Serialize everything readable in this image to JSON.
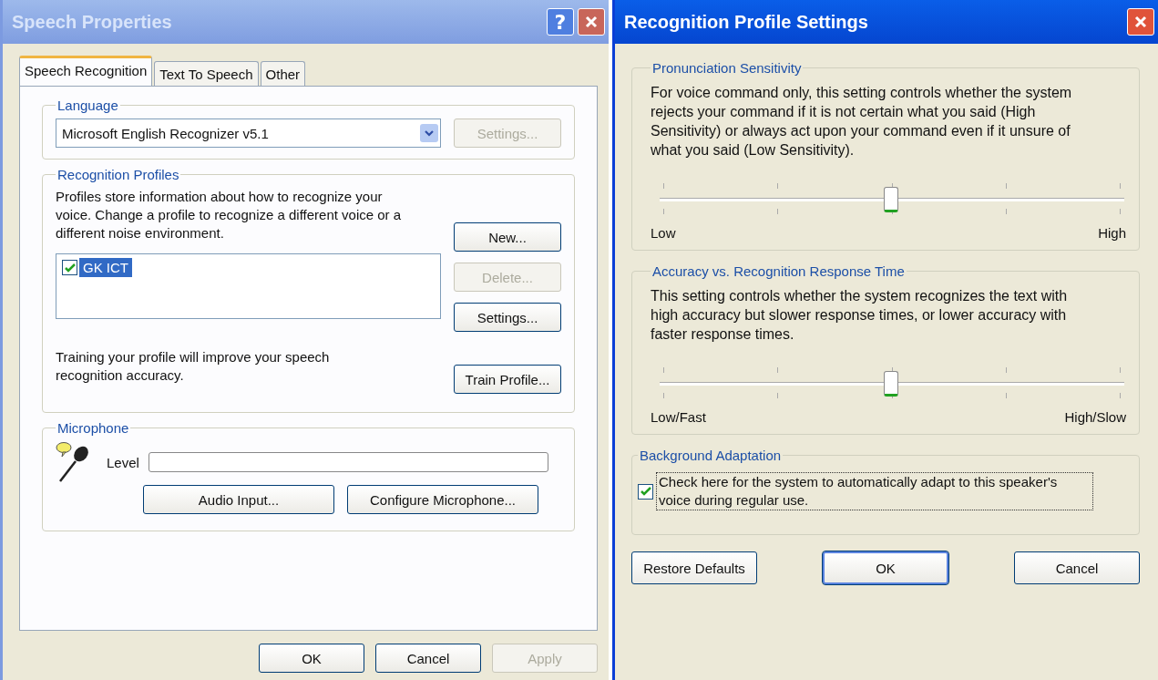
{
  "speech_properties": {
    "title": "Speech Properties",
    "active": false,
    "help": "?",
    "tabs": [
      {
        "label": "Speech Recognition",
        "selected": true
      },
      {
        "label": "Text To Speech",
        "selected": false
      },
      {
        "label": "Other",
        "selected": false
      }
    ],
    "language": {
      "legend": "Language",
      "value": "Microsoft English Recognizer v5.1",
      "button": {
        "label": "Settings...",
        "disabled": true
      }
    },
    "profiles": {
      "legend": "Recognition Profiles",
      "description": "Profiles store information about how to recognize your voice.  Change a profile to recognize a different voice or a different noise environment.",
      "items": [
        {
          "label": "GK ICT",
          "checked": true,
          "selected": true
        }
      ],
      "buttons": [
        {
          "label": "New...",
          "disabled": false
        },
        {
          "label": "Delete...",
          "disabled": true
        },
        {
          "label": "Settings...",
          "disabled": false
        }
      ],
      "training_text": "Training your profile will improve your speech recognition accuracy.",
      "train_button": {
        "label": "Train Profile...",
        "disabled": false
      }
    },
    "microphone": {
      "legend": "Microphone",
      "level_label": "Level",
      "buttons": [
        {
          "label": "Audio Input...",
          "disabled": false
        },
        {
          "label": "Configure Microphone...",
          "disabled": false
        }
      ]
    },
    "buttons": [
      {
        "label": "OK",
        "disabled": false
      },
      {
        "label": "Cancel",
        "disabled": false
      },
      {
        "label": "Apply",
        "disabled": true
      }
    ]
  },
  "profile_settings": {
    "title": "Recognition Profile Settings",
    "active": true,
    "sliders": [
      {
        "legend": "Pronunciation Sensitivity",
        "text": "For voice command only, this setting controls whether the system rejects your command if it is not certain what you said (High Sensitivity) or always act upon your command even if it unsure of what you said (Low Sensitivity).",
        "level": 0.5,
        "low_label": "Low",
        "high_label": "High"
      },
      {
        "legend": "Accuracy vs. Recognition Response Time",
        "text": "This setting controls whether the system recognizes the text with high accuracy but slower response times, or lower accuracy with faster response times.",
        "level": 0.5,
        "low_label": "Low/Fast",
        "high_label": "High/Slow"
      }
    ],
    "adaptation": {
      "legend": "Background Adaptation",
      "checked": true,
      "label": "Check here for the system to automatically adapt to this speaker's voice during regular use."
    },
    "buttons": [
      {
        "label": "Restore Defaults",
        "default": false
      },
      {
        "label": "OK",
        "default": true
      },
      {
        "label": "Cancel",
        "default": false
      }
    ]
  }
}
